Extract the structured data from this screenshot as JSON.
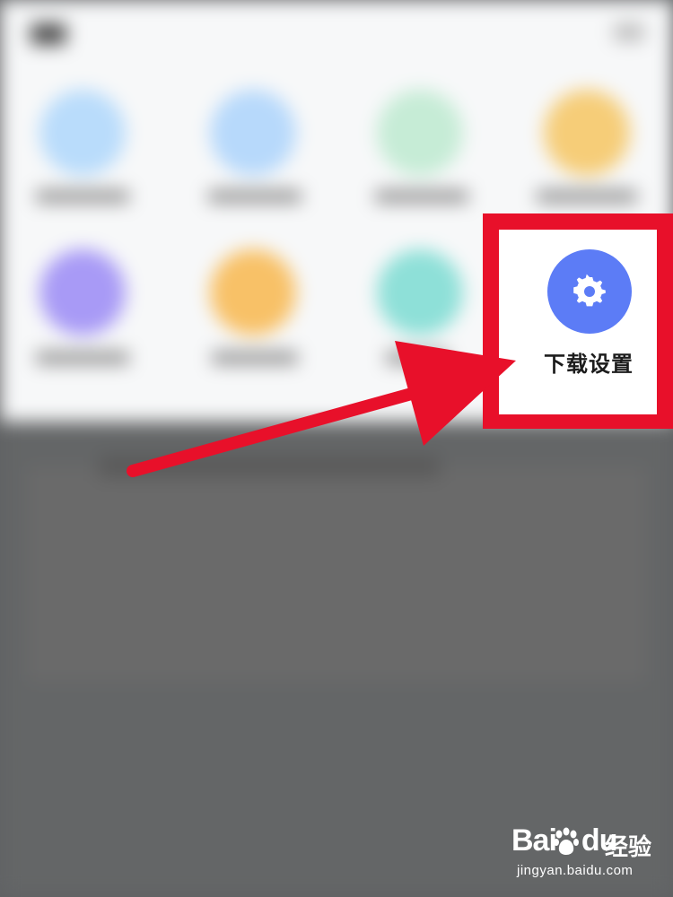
{
  "highlight": {
    "label": "下载设置",
    "icon": "gear-icon",
    "icon_color": "#5c7cf6",
    "frame_color": "#e8102a"
  },
  "blurred_icons": [
    {
      "color": "#b9dcfb"
    },
    {
      "color": "#b7d9fb"
    },
    {
      "color": "#c6ecd6"
    },
    {
      "color": "#f6cd78"
    },
    {
      "color": "#a89af6"
    },
    {
      "color": "#f8c167"
    },
    {
      "color": "#8ee0d8"
    }
  ],
  "watermark": {
    "brand": "Bai",
    "brand_suffix": "du",
    "product": "经验",
    "url": "jingyan.baidu.com"
  }
}
